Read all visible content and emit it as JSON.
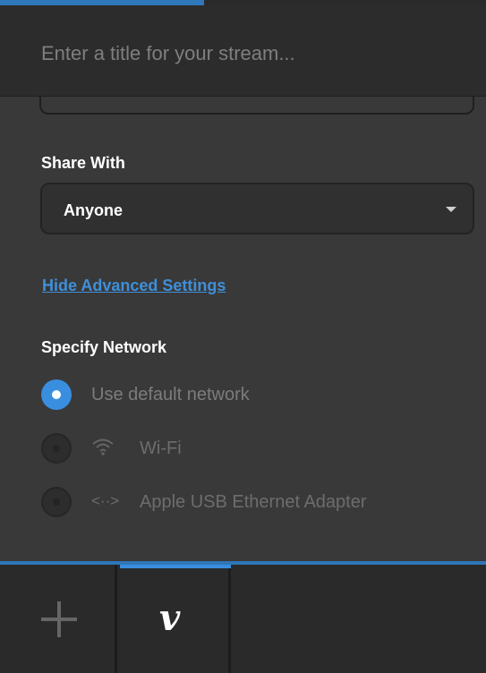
{
  "stream_title": {
    "placeholder": "Enter a title for your stream...",
    "value": ""
  },
  "share_with": {
    "label": "Share With",
    "selected": "Anyone",
    "caret_icon": "chevron-down-icon"
  },
  "advanced_link": {
    "label": "Hide Advanced Settings"
  },
  "network": {
    "label": "Specify Network",
    "options": [
      {
        "label": "Use default network",
        "selected": true,
        "icon": ""
      },
      {
        "label": "Wi-Fi",
        "selected": false,
        "icon": "wifi-icon"
      },
      {
        "label": "Apple USB Ethernet Adapter",
        "selected": false,
        "icon": "ethernet-icon",
        "icon_glyph": "<··>"
      }
    ]
  },
  "bottom_tabs": [
    {
      "name": "add",
      "icon": "plus-icon"
    },
    {
      "name": "vimeo",
      "icon": "vimeo-icon",
      "glyph": "v",
      "active": true
    }
  ],
  "colors": {
    "accent": "#3a8ee0",
    "panel": "#393939",
    "link": "#3f8fd9"
  }
}
